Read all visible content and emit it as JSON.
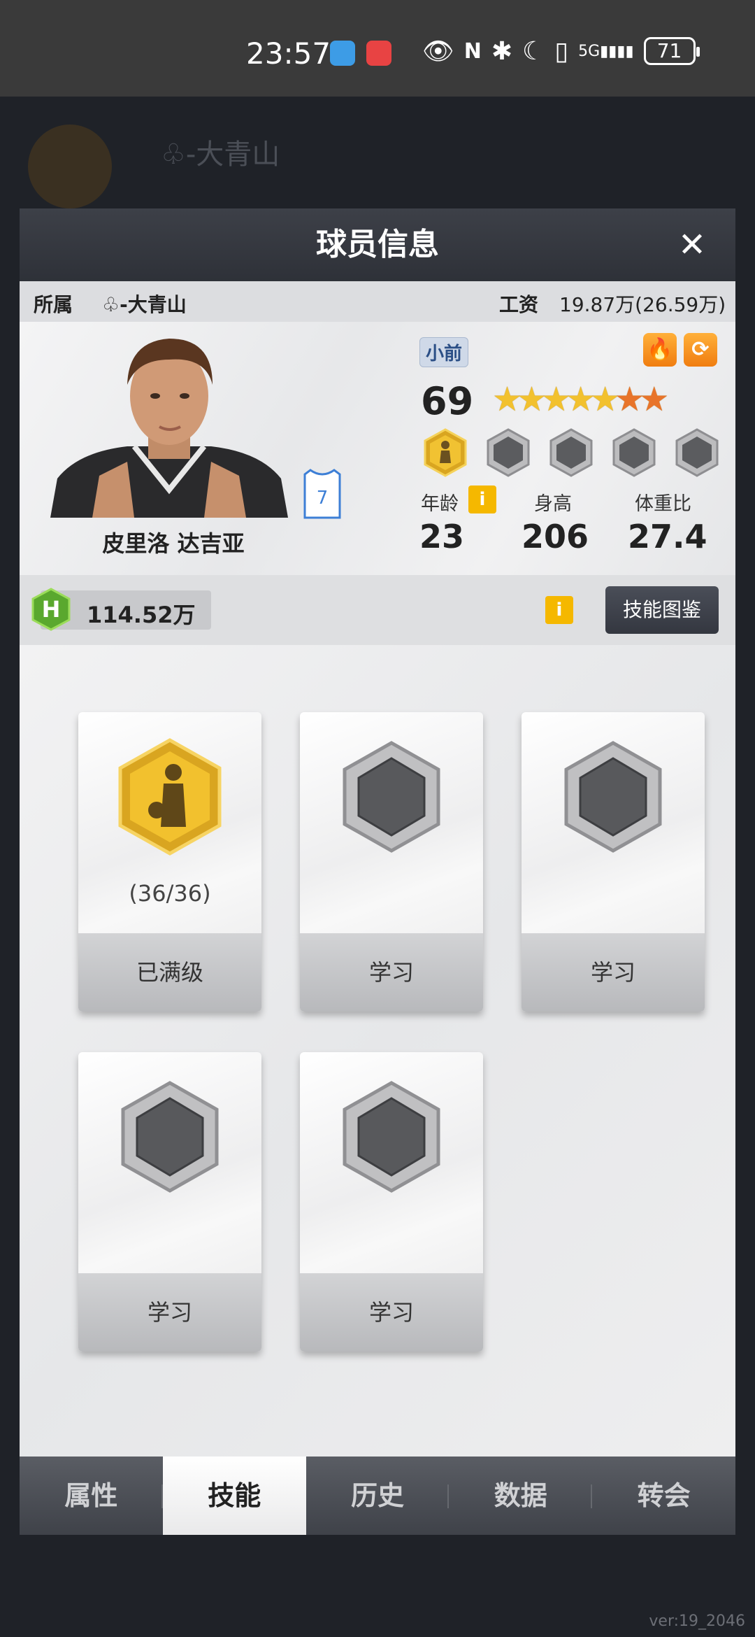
{
  "status_bar": {
    "time": "23:57",
    "network": "5G",
    "battery": "71"
  },
  "background": {
    "team_name": "♧-大青山",
    "version": "ver:19_2046"
  },
  "dialog": {
    "title": "球员信息",
    "affiliation_label": "所属",
    "affiliation_value": "♧-大青山",
    "salary_label": "工资",
    "salary_value": "19.87万(26.59万)",
    "player": {
      "name": "皮里洛 达吉亚",
      "jersey_number": "7",
      "position": "小前",
      "overall": "69",
      "stars_total": 7,
      "stars_gold": 5,
      "age_label": "年龄",
      "age": "23",
      "height_label": "身高",
      "height": "206",
      "weight_ratio_label": "体重比",
      "weight_ratio": "27.4"
    },
    "currency_value": "114.52万",
    "skill_guide_label": "技能图鉴",
    "skills": [
      {
        "status": "已满级",
        "progress": "(36/36)",
        "unlocked": true
      },
      {
        "status": "学习",
        "progress": "",
        "unlocked": false
      },
      {
        "status": "学习",
        "progress": "",
        "unlocked": false
      },
      {
        "status": "学习",
        "progress": "",
        "unlocked": false
      },
      {
        "status": "学习",
        "progress": "",
        "unlocked": false
      }
    ],
    "tabs": [
      "属性",
      "技能",
      "历史",
      "数据",
      "转会"
    ],
    "active_tab": "技能"
  },
  "colors": {
    "header": "#33363d",
    "accent_orange": "#f59a20",
    "gold": "#f2c12e",
    "money_green": "#7ac943"
  }
}
